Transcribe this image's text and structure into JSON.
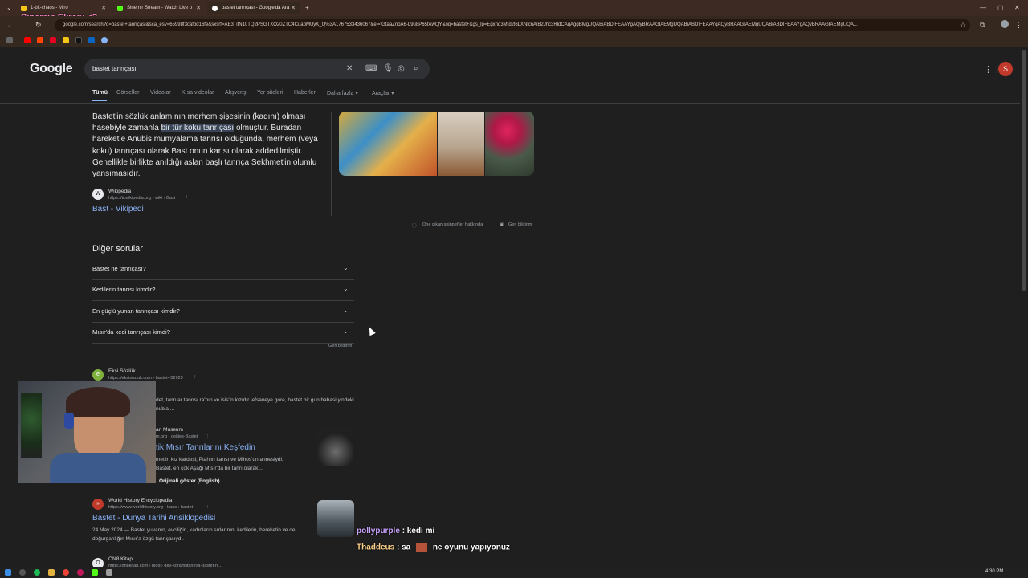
{
  "overlay": {
    "stream_title": "Sinemin Ekranı <3"
  },
  "browser": {
    "tabs": [
      {
        "label": "1-bit-chaos - Miro",
        "color": "#f5c518"
      },
      {
        "label": "Sinemir Stream - Watch Live o",
        "color": "#53fc18"
      },
      {
        "label": "bastet tanrıçası - Google'da Ara",
        "color": "#ffffff"
      }
    ],
    "url": "google.com/search?q=bastet+tanrıçası&sca_esv=65998f3cafbd16fe&sxsrf=AE3TifN10TQ2PSGTXO20ZTC4CuabMUyK_Q%3A1767533436067&ei=fGtaaZnoA6-L9u8P65fAwQY&oq=bastet+&gs_lp=Egxnd3Mtd2l6LXNlcnAiB2Jhc3RldCAqAggBMgUQABiABDIFEAAYgAQyBRAAGIAEMgUQABiABDIFEAAYgAQyBRAAGIAEMgUQABiABDIFEAAYgAQyBRAAGIAEMgUQA..."
  },
  "google": {
    "logo": "Google",
    "query": "bastet tanrıçası",
    "avatar_letter": "S",
    "tabs": [
      "Tümü",
      "Görseller",
      "Videolar",
      "Kısa videolar",
      "Alışveriş",
      "Yer siteleri",
      "Haberler",
      "Daha fazla ▾",
      "Araçlar ▾"
    ]
  },
  "featured": {
    "before": "Bastet'in sözlük anlamının merhem şişesinin (kadını) olması hasebiyle zamanla ",
    "highlight": "bir tür koku tanrıçası",
    "after": " olmuştur. Buradan hareketle Anubis mumyalama tanrısı olduğunda, merhem (veya koku) tanrıçası olarak Bast onun karısı olarak addedilmiştir. Genellikle birlikte anıldığı aslan başlı tanrıça Sekhmet'in olumlu yansımasıdır.",
    "source_name": "Wikipedia",
    "source_url": "https://tr.wikipedia.org › wiki › Bast",
    "link": "Bast - Vikipedi",
    "about": "Öne çıkan snippet'ler hakkında",
    "feedback": "Geri bildirim"
  },
  "paa": {
    "title": "Diğer sorular",
    "questions": [
      "Bastet ne tanrıçası?",
      "Kedilerin tanrısı kimdir?",
      "En güçlü yunan tanrıçası kimdir?",
      "Mısır'da kedi tanrıçası kimdi?"
    ],
    "feedback": "Geri bildirim"
  },
  "results": [
    {
      "source": "Ekşi Sözlük",
      "url": "https://eksisozluk.com › bastet--52925",
      "desc": "det, tanrılar tanrısı ra'nın ve isis'in kızıdır. efsaneye gore, bastet bir gun babasi yindeki nubia ..."
    },
    {
      "source": "an Museum",
      "url": "m.org › deities-Bastet",
      "title": "tik Mısır Tanrılarını Keşfedin",
      "desc1": "met'in kız kardeşi, Ptah'ın karısı ve Mihos'un annesiydi.",
      "desc2": "Bastet, en çok Aşağı Mısır'da bir tanrı olarak ...",
      "original": "Orijinali göster (English)"
    },
    {
      "source": "World History Encyclopedia",
      "url": "https://www.worldhistory.org › trans › bastet",
      "title": "Bastet - Dünya Tarihi Ansiklopedisi",
      "desc": "24 May 2024 — Bastet yuvanın, evciliğin, kadınların sırlarının, kedilerin, bereketin ve de doğurganlığın Mısır'a özgü tanrıçasıydı."
    },
    {
      "source": "ON8 Kitap",
      "url": "https://on8kitap.com › blog › dev-koramiltanriya-bastet-ni..."
    }
  ],
  "chat": [
    {
      "user": "pollypurple",
      "message": ": kedi mi"
    },
    {
      "user": "Thaddeus",
      "message": ": sa",
      "message2": "ne oyunu yapıyonuz"
    }
  ],
  "taskbar": {
    "time": "4:30 PM"
  }
}
